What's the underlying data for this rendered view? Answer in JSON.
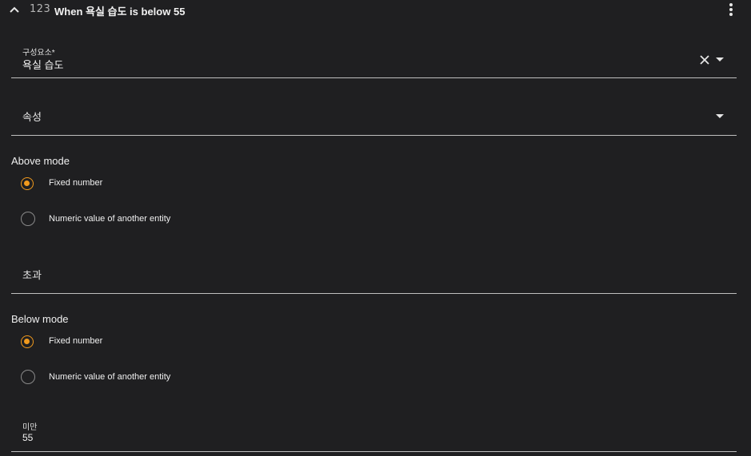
{
  "header": {
    "number_icon": "123",
    "title": "When 욕실 습도 is below 55"
  },
  "icons": {
    "collapse": "chevron-up-icon",
    "menu": "more-vert-icon",
    "clear": "close-icon",
    "dropdown": "arrow-drop-down-icon"
  },
  "entity_field": {
    "label": "구성요소*",
    "value": "욕실 습도"
  },
  "attribute_field": {
    "label": "속성"
  },
  "above": {
    "section_label": "Above mode",
    "options": [
      "Fixed number",
      "Numeric value of another entity"
    ],
    "selected": "Fixed number",
    "field_label": "초과"
  },
  "below": {
    "section_label": "Below mode",
    "options": [
      "Fixed number",
      "Numeric value of another entity"
    ],
    "selected": "Fixed number",
    "field_label": "미만",
    "field_value": "55"
  },
  "colors": {
    "background": "#1f1f21",
    "accent": "#f29a1d",
    "underline": "#bfbfbf"
  }
}
